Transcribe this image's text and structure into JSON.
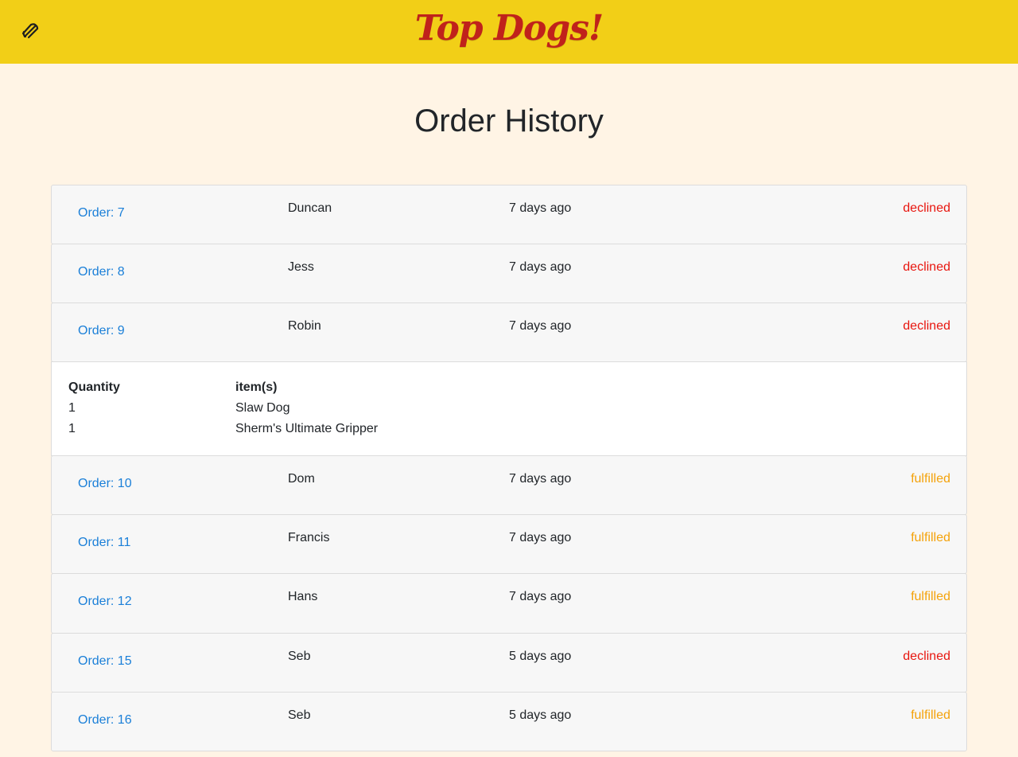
{
  "header": {
    "brand": "Top Dogs!",
    "menu_icon": "hotdog-menu-icon",
    "background_color": "#f2cf17",
    "brand_color": "#c0221b"
  },
  "page": {
    "title": "Order History"
  },
  "colors": {
    "link": "#1a7fd8",
    "declined": "#e8160f",
    "fulfilled": "#f4a20a",
    "page_background": "#fff4e5"
  },
  "orders": [
    {
      "label": "Order: 7",
      "customer": "Duncan",
      "time": "7 days ago",
      "status": "declined"
    },
    {
      "label": "Order: 8",
      "customer": "Jess",
      "time": "7 days ago",
      "status": "declined"
    },
    {
      "label": "Order: 9",
      "customer": "Robin",
      "time": "7 days ago",
      "status": "declined"
    },
    {
      "label": "Order: 10",
      "customer": "Dom",
      "time": "7 days ago",
      "status": "fulfilled"
    },
    {
      "label": "Order: 11",
      "customer": "Francis",
      "time": "7 days ago",
      "status": "fulfilled"
    },
    {
      "label": "Order: 12",
      "customer": "Hans",
      "time": "7 days ago",
      "status": "fulfilled"
    },
    {
      "label": "Order: 15",
      "customer": "Seb",
      "time": "5 days ago",
      "status": "declined"
    },
    {
      "label": "Order: 16",
      "customer": "Seb",
      "time": "5 days ago",
      "status": "fulfilled"
    }
  ],
  "expanded_order": {
    "quantity_header": "Quantity",
    "items_header": "item(s)",
    "lines": [
      {
        "quantity": "1",
        "item": "Slaw Dog"
      },
      {
        "quantity": "1",
        "item": "Sherm's Ultimate Gripper"
      }
    ]
  }
}
